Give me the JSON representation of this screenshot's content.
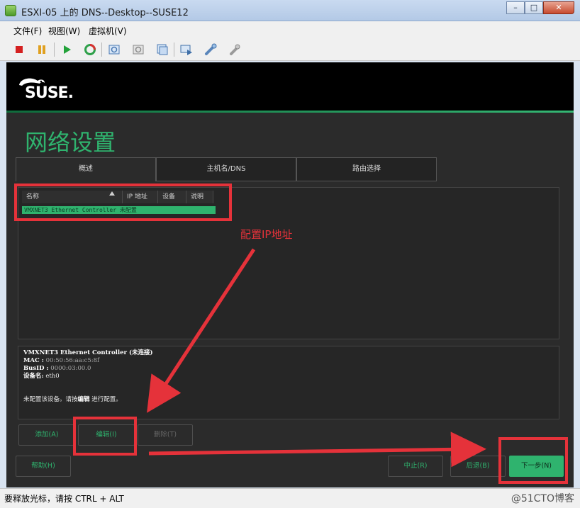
{
  "window": {
    "title": "ESXI-05 上的 DNS--Desktop--SUSE12",
    "minimize": "–",
    "maximize": "□",
    "close": "✕"
  },
  "menu": [
    "文件(F)",
    "视图(W)",
    "虚拟机(V)"
  ],
  "toolbar_icons": [
    "stop-icon",
    "pause-icon",
    "play-icon",
    "reset-icon",
    "snapshot-icon",
    "revert-snapshot-icon",
    "manage-snapshots-icon",
    "console-icon",
    "connect-device-icon",
    "settings-icon"
  ],
  "guest": {
    "logo": "SUSE.",
    "page_title": "网络设置",
    "tabs": [
      "概述",
      "主机名/DNS",
      "路由选择"
    ],
    "table": {
      "headers": [
        "名称",
        "IP 地址",
        "设备",
        "说明"
      ],
      "rows": [
        {
          "name": "VMXNET3 Ethernet Controller",
          "status": "未配置"
        }
      ]
    },
    "detail": {
      "title": "VMXNET3 Ethernet Controller (未连接)",
      "mac_label": "MAC :",
      "mac_value": "00:50:56:aa:c5:8f",
      "busid_label": "BusID :",
      "busid_value": "0000:03:00.0",
      "device_label": "设备名:",
      "device_value": "eth0",
      "note_prefix": "未配置该设备。请按",
      "note_bold": "编辑",
      "note_suffix": "进行配置。"
    },
    "buttons": {
      "add": "添加(A)",
      "edit": "编辑(I)",
      "delete": "删除(T)",
      "help": "帮助(H)",
      "abort": "中止(R)",
      "back": "后退(B)",
      "next": "下一步(N)"
    }
  },
  "annotation": {
    "text": "配置IP地址",
    "color": "#e5323a"
  },
  "status": {
    "text": "要释放光标，请按 CTRL + ALT",
    "watermark": "@51CTO博客"
  },
  "colors": {
    "accent": "#2fb36e",
    "annotation": "#e5323a"
  }
}
